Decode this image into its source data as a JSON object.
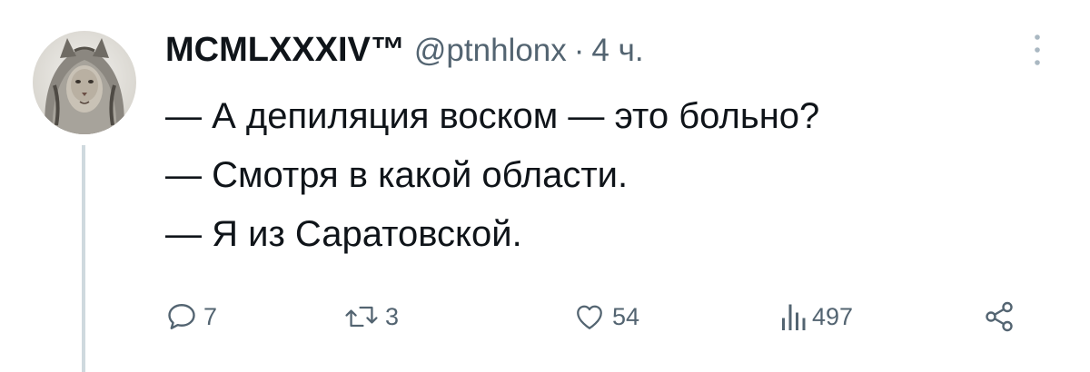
{
  "tweet": {
    "display_name": "MCMLXXXIV™",
    "handle": "@ptnhlonx",
    "separator": "·",
    "time": "4 ч.",
    "lines": [
      "— А депиляция воском — это больно?",
      "— Смотря в какой области.",
      "— Я из Саратовской."
    ]
  },
  "actions": {
    "reply_icon": "reply-icon",
    "reply_count": "7",
    "retweet_icon": "retweet-icon",
    "retweet_count": "3",
    "like_icon": "heart-icon",
    "like_count": "54",
    "views_icon": "views-chart-icon",
    "views_count": "497",
    "share_icon": "share-icon"
  },
  "colors": {
    "text": "#0f1419",
    "secondary": "#536471",
    "thread_line": "#cfd9de"
  }
}
